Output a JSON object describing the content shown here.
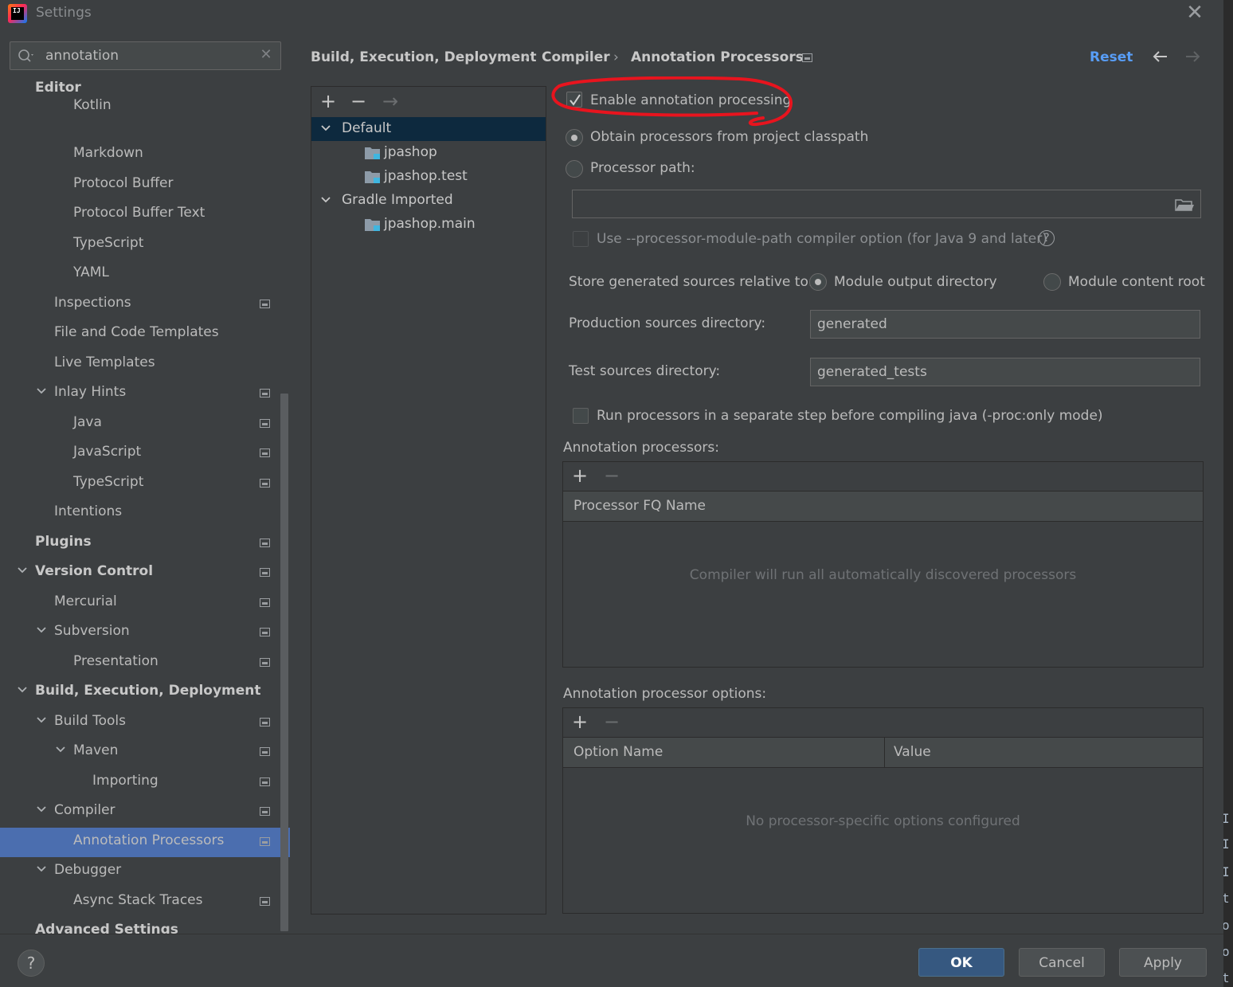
{
  "window": {
    "title": "Settings",
    "close_glyph": "✕"
  },
  "search": {
    "value": "annotation",
    "clear_glyph": "✕"
  },
  "sidebar": {
    "items": [
      {
        "label": "Editor",
        "bold": true,
        "indent": 0,
        "chevron": false
      },
      {
        "label": "Kotlin",
        "indent": 2
      },
      {
        "label": "Markdown",
        "indent": 2
      },
      {
        "label": "Protocol Buffer",
        "indent": 2
      },
      {
        "label": "Protocol Buffer Text",
        "indent": 2
      },
      {
        "label": "TypeScript",
        "indent": 2
      },
      {
        "label": "YAML",
        "indent": 2
      },
      {
        "label": "Inspections",
        "indent": 1,
        "project": true
      },
      {
        "label": "File and Code Templates",
        "indent": 1
      },
      {
        "label": "Live Templates",
        "indent": 1
      },
      {
        "label": "Inlay Hints",
        "indent": 1,
        "chevron": true,
        "project": true
      },
      {
        "label": "Java",
        "indent": 2,
        "project": true
      },
      {
        "label": "JavaScript",
        "indent": 2,
        "project": true
      },
      {
        "label": "TypeScript",
        "indent": 2,
        "project": true
      },
      {
        "label": "Intentions",
        "indent": 1
      },
      {
        "label": "Plugins",
        "bold": true,
        "indent": 0,
        "project": true
      },
      {
        "label": "Version Control",
        "bold": true,
        "indent": 0,
        "chevron": true,
        "project": true
      },
      {
        "label": "Mercurial",
        "indent": 1,
        "project": true
      },
      {
        "label": "Subversion",
        "indent": 1,
        "chevron": true,
        "project": true
      },
      {
        "label": "Presentation",
        "indent": 2,
        "project": true
      },
      {
        "label": "Build, Execution, Deployment",
        "bold": true,
        "indent": 0,
        "chevron": true
      },
      {
        "label": "Build Tools",
        "indent": 1,
        "chevron": true,
        "project": true
      },
      {
        "label": "Maven",
        "indent": 2,
        "chevron": true,
        "project": true
      },
      {
        "label": "Importing",
        "indent": 3,
        "project": true
      },
      {
        "label": "Compiler",
        "indent": 1,
        "chevron": true,
        "project": true
      },
      {
        "label": "Annotation Processors",
        "indent": 2,
        "project": true,
        "selected": true
      },
      {
        "label": "Debugger",
        "indent": 1,
        "chevron": true
      },
      {
        "label": "Async Stack Traces",
        "indent": 2,
        "project": true
      },
      {
        "label": "Advanced Settings",
        "bold": true,
        "indent": 0
      }
    ]
  },
  "breadcrumb": {
    "parts": [
      "Build, Execution, Deployment",
      "Compiler",
      "Annotation Processors"
    ],
    "separator": "›"
  },
  "header": {
    "reset_label": "Reset"
  },
  "profiles": {
    "toolbar": {
      "add": "+",
      "remove": "−",
      "move": "→"
    },
    "tree": [
      {
        "label": "Default",
        "level": 0,
        "chevron": true,
        "selected": true
      },
      {
        "label": "jpashop",
        "level": 1,
        "folder": true
      },
      {
        "label": "jpashop.test",
        "level": 1,
        "folder": true
      },
      {
        "label": "Gradle Imported",
        "level": 0,
        "chevron": true
      },
      {
        "label": "jpashop.main",
        "level": 1,
        "folder": true
      }
    ]
  },
  "settings": {
    "enable_processing": {
      "label": "Enable annotation processing",
      "checked": true
    },
    "obtain_classpath": {
      "label": "Obtain processors from project classpath",
      "selected": true
    },
    "processor_path": {
      "label": "Processor path:",
      "selected": false,
      "value": ""
    },
    "module_path_option": {
      "label": "Use --processor-module-path compiler option (for Java 9 and later)",
      "checked": false,
      "help": "?"
    },
    "store_relative": {
      "label": "Store generated sources relative to:",
      "option_output": "Module output directory",
      "option_content": "Module content root",
      "selected": "Module output directory"
    },
    "production_dir": {
      "label": "Production sources directory:",
      "value": "generated"
    },
    "test_dir": {
      "label": "Test sources directory:",
      "value": "generated_tests"
    },
    "separate_step": {
      "label": "Run processors in a separate step before compiling java (-proc:only mode)",
      "checked": false
    }
  },
  "processors_panel": {
    "title": "Annotation processors:",
    "add": "+",
    "remove": "−",
    "column": "Processor FQ Name",
    "empty_text": "Compiler will run all automatically discovered processors"
  },
  "options_panel": {
    "title": "Annotation processor options:",
    "add": "+",
    "remove": "−",
    "columns": [
      "Option Name",
      "Value"
    ],
    "empty_text": "No processor-specific options configured"
  },
  "footer": {
    "help": "?",
    "ok_label": "OK",
    "cancel_label": "Cancel",
    "apply_label": "Apply"
  },
  "colors": {
    "background": "#3c3f41",
    "selection": "#4b6eaf",
    "link": "#589df6",
    "primary_button": "#365880",
    "annotation_mark": "#e8141e"
  },
  "icons": [
    "search-icon",
    "close-icon",
    "chevron-down-icon",
    "project-scope-icon",
    "folder-icon",
    "back-arrow-icon",
    "forward-arrow-icon",
    "help-icon",
    "browse-folder-icon"
  ]
}
